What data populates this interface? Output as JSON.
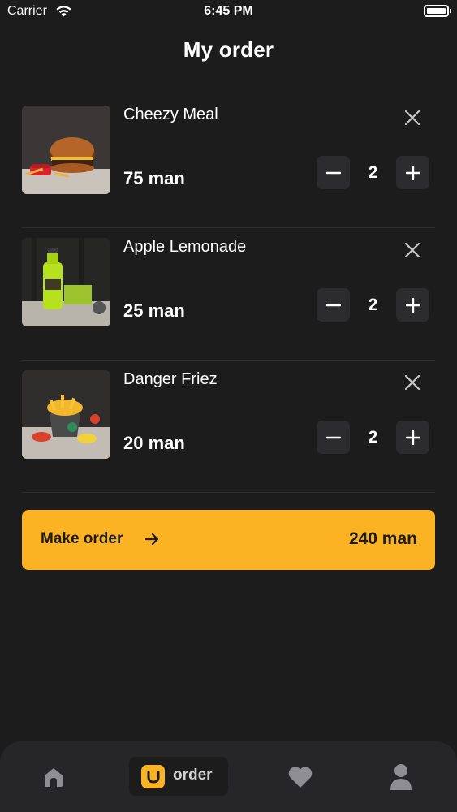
{
  "status_bar": {
    "carrier": "Carrier",
    "time": "6:45 PM"
  },
  "header": {
    "title": "My order"
  },
  "order_items": [
    {
      "name": "Cheezy Meal",
      "price": "75 man",
      "quantity": "2",
      "image": "burger"
    },
    {
      "name": "Apple Lemonade",
      "price": "25 man",
      "quantity": "2",
      "image": "lemonade"
    },
    {
      "name": "Danger Friez",
      "price": "20 man",
      "quantity": "2",
      "image": "fries"
    }
  ],
  "checkout": {
    "label": "Make order",
    "total": "240 man"
  },
  "tab_bar": {
    "order_label": "order"
  },
  "icons": {
    "remove": "close-icon",
    "minus": "minus-icon",
    "plus": "plus-icon",
    "arrow": "arrow-right-icon",
    "home": "home-icon",
    "bag": "shopping-bag-icon",
    "favorite": "heart-icon",
    "profile": "profile-icon"
  },
  "colors": {
    "background": "#1c1c1d",
    "accent": "#fbb323",
    "button": "#2c2c2e",
    "tab_bar": "#262628"
  }
}
